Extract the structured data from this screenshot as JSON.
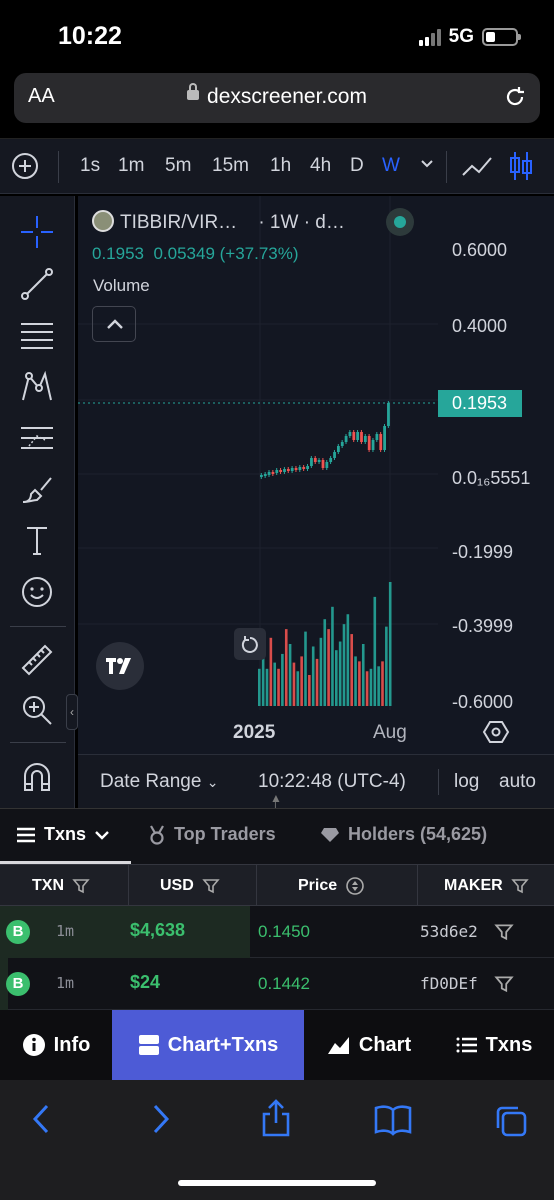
{
  "status": {
    "time": "10:22",
    "network": "5G"
  },
  "browser": {
    "text_size_label": "AA",
    "url": "dexscreener.com"
  },
  "toolbar": {
    "intervals": [
      "1s",
      "1m",
      "5m",
      "15m",
      "1h",
      "4h",
      "D",
      "W"
    ],
    "active_interval": "W"
  },
  "chart": {
    "pair": "TIBBIR/VIR…",
    "interval_info": "· 1W · d…",
    "ohlc_close": "0.1953",
    "ohlc_change": "0.05349 (+37.73%)",
    "volume_label": "Volume",
    "price_labels": [
      "0.6000",
      "0.4000",
      "0.0₁₆5551",
      "-0.1999",
      "-0.3999",
      "-0.6000"
    ],
    "current_price": "0.1953",
    "time_labels": [
      "2025",
      "Aug"
    ],
    "accent_up": "#26a69a",
    "accent_down": "#ef5350"
  },
  "chart_footer": {
    "date_range": "Date Range",
    "clock": "10:22:48 (UTC-4)",
    "log": "log",
    "auto": "auto"
  },
  "tabs": {
    "txns": "Txns",
    "top_traders": "Top Traders",
    "holders": "Holders (54,625)"
  },
  "table": {
    "headers": [
      "TXN",
      "USD",
      "Price",
      "MAKER"
    ],
    "rows": [
      {
        "type": "B",
        "age": "1m",
        "usd": "$4,638",
        "price": "0.1450",
        "maker": "53d6e2"
      },
      {
        "type": "B",
        "age": "1m",
        "usd": "$24",
        "price": "0.1442",
        "maker": "fD0DEf"
      }
    ]
  },
  "bottom_nav": {
    "info": "Info",
    "chart_txns": "Chart+Txns",
    "chart": "Chart",
    "txns": "Txns"
  }
}
